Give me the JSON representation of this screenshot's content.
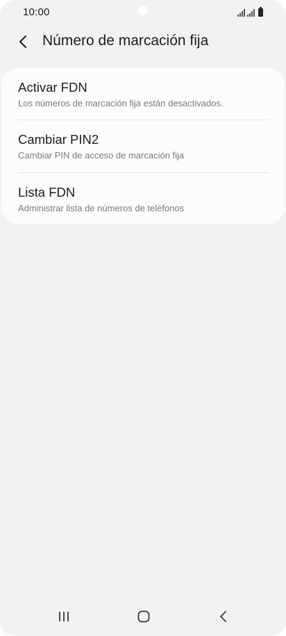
{
  "status_bar": {
    "time": "10:00",
    "icons": [
      "signal-icon",
      "signal-icon",
      "battery-icon"
    ]
  },
  "header": {
    "title": "Número de marcación fija",
    "back_icon": "chevron-left-icon"
  },
  "settings": {
    "items": [
      {
        "title": "Activar FDN",
        "subtitle": "Los números de marcación fija están desactivados."
      },
      {
        "title": "Cambiar PIN2",
        "subtitle": "Cambiar PIN de acceso de marcación fija"
      },
      {
        "title": "Lista FDN",
        "subtitle": "Administrar lista de números de teléfonos"
      }
    ]
  },
  "nav_bar": {
    "recents_icon": "recents-icon",
    "home_icon": "home-icon",
    "back_icon": "back-icon"
  },
  "colors": {
    "background": "#f2f2f2",
    "card": "#fcfcfc",
    "title_text": "#1c1c1c",
    "subtitle_text": "#7a7a7a",
    "divider": "#e2e2e2"
  }
}
